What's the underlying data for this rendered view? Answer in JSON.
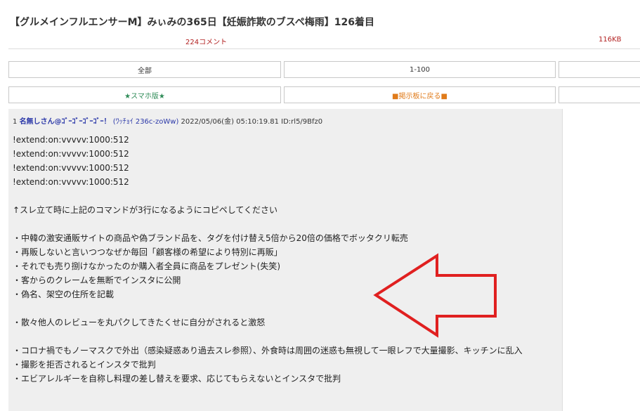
{
  "thread": {
    "title": "【グルメインフルエンサーM】みぃみの365日【妊娠詐欺のブスペ梅雨】126着目",
    "comment_count": "224コメント",
    "size": "116KB"
  },
  "nav": {
    "all_label": "全部",
    "range_label": "1-100",
    "smartphone_label": "★スマホ版★",
    "back_label": "■掲示板に戻る■"
  },
  "post": {
    "number": "1",
    "name": "名無しさん@ｺﾞｰｺﾞｰｺﾞｰｺﾞｰ！",
    "id_info": "(ﾜｯﾁｮｲ 236c-zoWw)",
    "datetime": "2022/05/06(金) 05:10:19.81 ID:rl5/9Bfz0",
    "lines": [
      "!extend:on:vvvvv:1000:512",
      "!extend:on:vvvvv:1000:512",
      "!extend:on:vvvvv:1000:512",
      "!extend:on:vvvvv:1000:512",
      "",
      "↑スレ立て時に上記のコマンドが3行になるようにコピペしてください",
      "",
      "・中韓の激安通販サイトの商品や偽ブランド品を、タグを付け替え5倍から20倍の価格でボッタクリ転売",
      "・再販しないと言いつつなぜか毎回「顧客様の希望により特別に再販」",
      "・それでも売り捌けなかったのか購入者全員に商品をプレゼント(失笑)",
      "・客からのクレームを無断でインスタに公開",
      "・偽名、架空の住所を記載",
      "",
      "・散々他人のレビューを丸パクしてきたくせに自分がされると激怒",
      "",
      "・コロナ禍でもノーマスクで外出（感染疑惑あり過去スレ参照）、外食時は周囲の迷惑も無視して一眼レフで大量撮影、キッチンに乱入",
      "・撮影を拒否されるとインスタで批判",
      "・エビアレルギーを自称し料理の差し替えを要求、応じてもらえないとインスタで批判"
    ]
  },
  "annotation": {
    "arrow_icon": "left-arrow-icon",
    "arrow_color": "#e02020"
  }
}
